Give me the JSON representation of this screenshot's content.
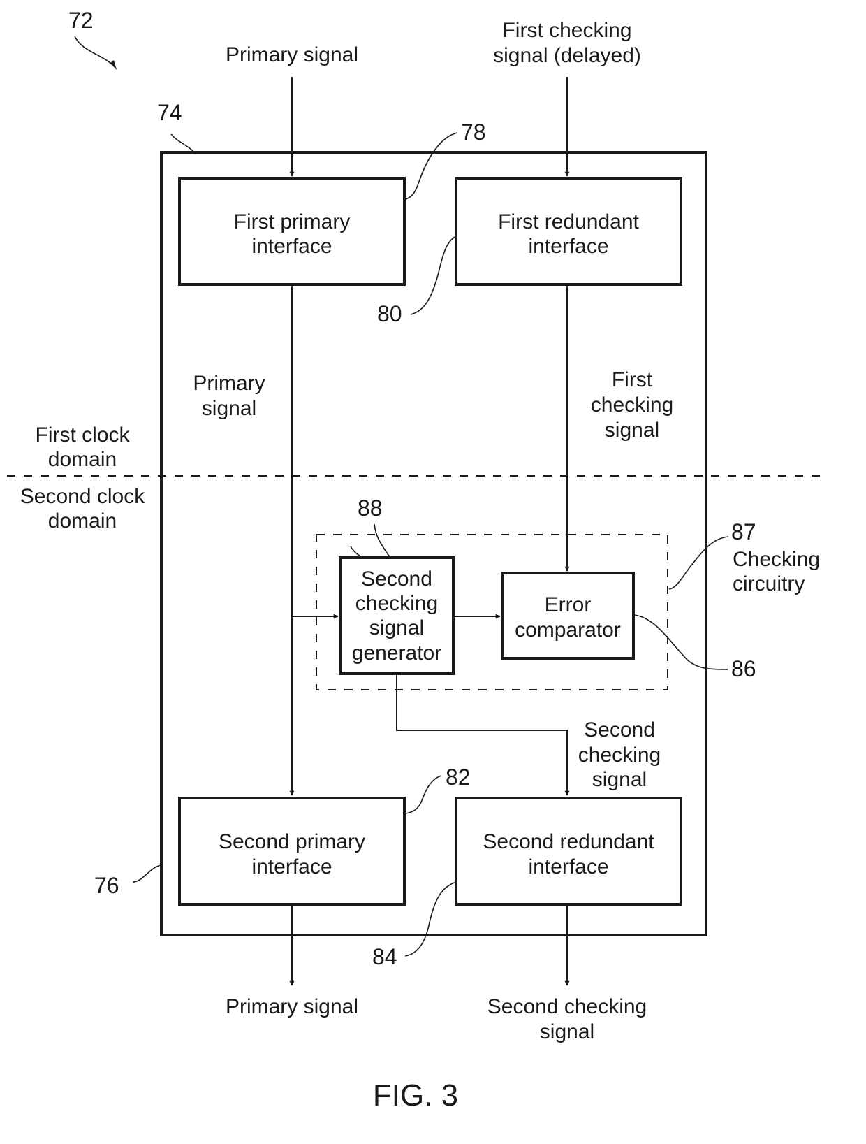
{
  "figure": {
    "caption": "FIG. 3",
    "reference_numeral": "72"
  },
  "inputs": {
    "primary_signal": "Primary signal",
    "first_checking_delayed": [
      "First checking",
      "signal (delayed)"
    ]
  },
  "outputs": {
    "primary_signal": "Primary signal",
    "second_checking": [
      "Second checking",
      "signal"
    ]
  },
  "domains": {
    "first": [
      "First clock",
      "domain"
    ],
    "second": [
      "Second clock",
      "domain"
    ]
  },
  "outer_block": {
    "ref_top": "74",
    "ref_bottom": "76"
  },
  "blocks": {
    "first_primary_interface": {
      "label": [
        "First primary",
        "interface"
      ],
      "ref": "78"
    },
    "first_redundant_interface": {
      "label": [
        "First redundant",
        "interface"
      ],
      "ref": "80"
    },
    "second_primary_interface": {
      "label": [
        "Second primary",
        "interface"
      ],
      "ref": "82"
    },
    "second_redundant_interface": {
      "label": [
        "Second redundant",
        "interface"
      ],
      "ref": "84"
    },
    "error_comparator": {
      "label": [
        "Error",
        "comparator"
      ],
      "ref": "86"
    },
    "second_checking_signal_generator": {
      "label": [
        "Second",
        "checking",
        "signal",
        "generator"
      ],
      "ref": "88"
    },
    "checking_circuitry": {
      "label": [
        "Checking",
        "circuitry"
      ],
      "ref": "87"
    }
  },
  "wire_labels": {
    "primary_signal_mid": [
      "Primary",
      "signal"
    ],
    "first_checking_signal": [
      "First",
      "checking",
      "signal"
    ],
    "second_checking_signal": [
      "Second",
      "checking",
      "signal"
    ]
  }
}
